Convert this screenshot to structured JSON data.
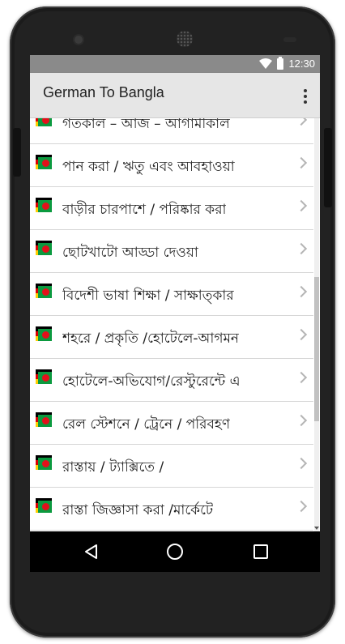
{
  "status_bar": {
    "time": "12:30",
    "wifi_icon": "wifi-icon",
    "battery_icon": "battery-icon"
  },
  "app_bar": {
    "title": "German To Bangla",
    "menu_icon": "overflow-menu-icon"
  },
  "list": {
    "items": [
      {
        "label": "গতকাল – আজ – আগামীকাল"
      },
      {
        "label": "পান করা / ঋতু এবং আবহাওয়া"
      },
      {
        "label": "বাড়ীর চারপাশে / পরিষ্কার করা"
      },
      {
        "label": "ছোটখাটো আড্ডা দেওয়া"
      },
      {
        "label": "বিদেশী ভাষা শিক্ষা / সাক্ষাত্কার"
      },
      {
        "label": "শহরে / প্রকৃতি /হোটেলে-আগমন"
      },
      {
        "label": "হোটেলে-অভিযোগ/রেস্টুরেন্টে এ"
      },
      {
        "label": "রেল স্টেশনে / ট্রেনে / পরিবহণ"
      },
      {
        "label": "রাস্তায় / ট্যাক্সিতে /"
      },
      {
        "label": "রাস্তা জিজ্ঞাসা করা /মার্কেটে"
      }
    ],
    "colors": {
      "de_black": "#000000",
      "de_red": "#dd0000",
      "de_gold": "#ffce00",
      "bd_green": "#0b9a3f",
      "bd_red": "#e3101b"
    }
  },
  "nav_bar": {
    "back_icon": "back-triangle-icon",
    "home_icon": "home-circle-icon",
    "recents_icon": "recents-square-icon"
  }
}
